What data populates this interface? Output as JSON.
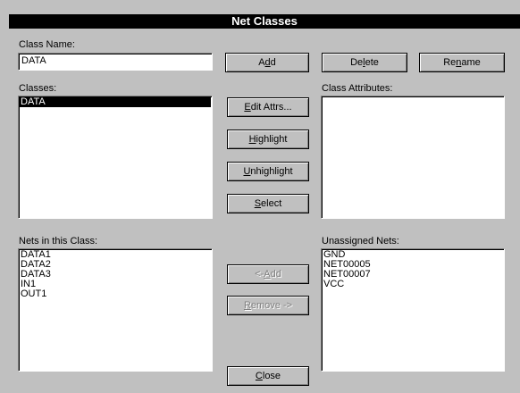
{
  "dialog": {
    "title": "Net Classes"
  },
  "class_name": {
    "label": "Class Name:",
    "value": "DATA"
  },
  "buttons": {
    "add": {
      "pre": "A",
      "key": "d",
      "post": "d"
    },
    "delete": {
      "pre": "De",
      "key": "l",
      "post": "ete"
    },
    "rename": {
      "pre": "Re",
      "key": "n",
      "post": "ame"
    },
    "edit_attrs": {
      "pre": "",
      "key": "E",
      "post": "dit Attrs..."
    },
    "highlight": {
      "pre": "",
      "key": "H",
      "post": "ighlight"
    },
    "unhighlight": {
      "pre": "",
      "key": "U",
      "post": "nhighlight"
    },
    "select": {
      "pre": "",
      "key": "S",
      "post": "elect"
    },
    "add_to_class": {
      "pre": "<- ",
      "key": "A",
      "post": "dd"
    },
    "remove": {
      "pre": "",
      "key": "R",
      "post": "emove ->"
    },
    "close": {
      "pre": "",
      "key": "C",
      "post": "lose"
    }
  },
  "classes": {
    "label": "Classes:",
    "items": [
      "DATA"
    ],
    "selected": "DATA"
  },
  "class_attributes": {
    "label": "Class Attributes:",
    "items": []
  },
  "nets_in_class": {
    "label": "Nets in this Class:",
    "items": [
      "DATA1",
      "DATA2",
      "DATA3",
      "IN1",
      "OUT1"
    ]
  },
  "unassigned_nets": {
    "label": "Unassigned Nets:",
    "items": [
      "GND",
      "NET00005",
      "NET00007",
      "VCC"
    ]
  }
}
